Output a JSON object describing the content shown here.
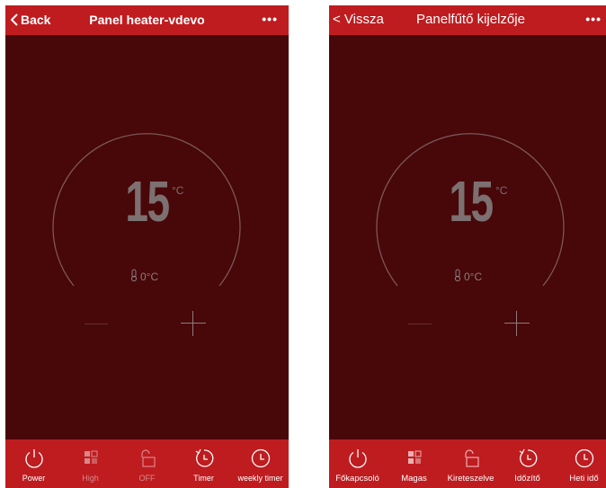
{
  "screens": [
    {
      "back_label": "Back",
      "title": "Panel heater-vdevo",
      "more_label": "•••",
      "temperature": "15",
      "temp_unit": "°C",
      "current_temp": "0°C",
      "tabs": [
        {
          "label": "Power",
          "icon": "power-icon",
          "active": true
        },
        {
          "label": "High",
          "icon": "mode-icon",
          "active": false
        },
        {
          "label": "OFF",
          "icon": "lock-icon",
          "active": false
        },
        {
          "label": "Timer",
          "icon": "timer-icon",
          "active": true
        },
        {
          "label": "weekly timer",
          "icon": "clock-icon",
          "active": true
        }
      ]
    },
    {
      "back_label": "< Vissza",
      "title": "Panelfűtő kijelzője",
      "more_label": "•••",
      "temperature": "15",
      "temp_unit": "°C",
      "current_temp": "0°C",
      "tabs": [
        {
          "label": "Főkapcsoló",
          "icon": "power-icon",
          "active": true
        },
        {
          "label": "Magas",
          "icon": "mode-icon",
          "active": true
        },
        {
          "label": "Kireteszelve",
          "icon": "lock-icon",
          "active": true
        },
        {
          "label": "Időzítő",
          "icon": "timer-icon",
          "active": true
        },
        {
          "label": "Heti idő",
          "icon": "clock-icon",
          "active": true
        }
      ]
    }
  ],
  "colors": {
    "header": "#bf1c20",
    "background": "#480709",
    "dial_ring": "#7a5858",
    "icon_active": "#ffffff",
    "icon_dim": "#d98789"
  }
}
